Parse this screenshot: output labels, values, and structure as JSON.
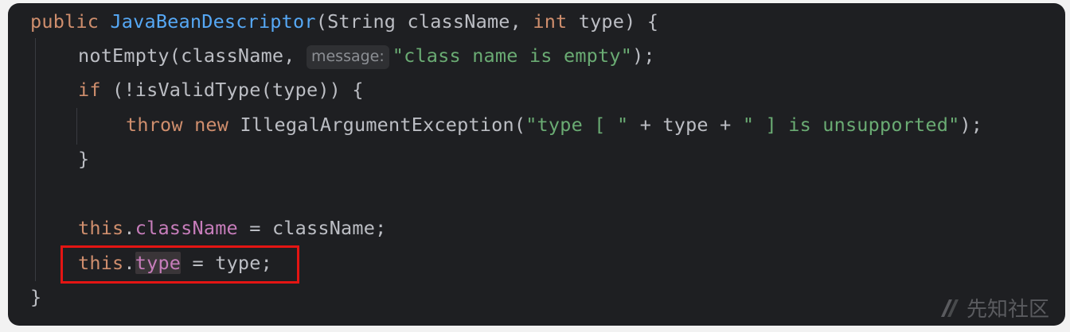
{
  "editor": {
    "language": "java",
    "line_numbers_shown": false,
    "inlay_hint": "message:",
    "lines": [
      {
        "indent": 0,
        "tokens": [
          {
            "t": "public ",
            "c": "kw"
          },
          {
            "t": "JavaBeanDescriptor",
            "c": "fn"
          },
          {
            "t": "(String className, ",
            "c": "plain"
          },
          {
            "t": "int",
            "c": "kw"
          },
          {
            "t": " type) {",
            "c": "plain"
          }
        ]
      },
      {
        "indent": 1,
        "tokens": [
          {
            "t": "notEmpty(className, ",
            "c": "plain"
          },
          {
            "t": "message:",
            "c": "hint"
          },
          {
            "t": "\"class name is empty\"",
            "c": "str"
          },
          {
            "t": ");",
            "c": "plain"
          }
        ]
      },
      {
        "indent": 1,
        "tokens": [
          {
            "t": "if",
            "c": "kw"
          },
          {
            "t": " (!isValidType(type)) {",
            "c": "plain"
          }
        ]
      },
      {
        "indent": 2,
        "tokens": [
          {
            "t": "throw new ",
            "c": "kw"
          },
          {
            "t": "IllegalArgumentException(",
            "c": "plain"
          },
          {
            "t": "\"type [ \"",
            "c": "str"
          },
          {
            "t": " + type + ",
            "c": "plain"
          },
          {
            "t": "\" ] is unsupported\"",
            "c": "str"
          },
          {
            "t": ");",
            "c": "plain"
          }
        ]
      },
      {
        "indent": 1,
        "tokens": [
          {
            "t": "}",
            "c": "plain"
          }
        ]
      },
      {
        "indent": 1,
        "tokens": []
      },
      {
        "indent": 1,
        "tokens": [
          {
            "t": "this",
            "c": "kw"
          },
          {
            "t": ".",
            "c": "plain"
          },
          {
            "t": "className",
            "c": "fld"
          },
          {
            "t": " = className;",
            "c": "plain"
          }
        ]
      },
      {
        "indent": 1,
        "tokens": [
          {
            "t": "this",
            "c": "kw"
          },
          {
            "t": ".",
            "c": "plain"
          },
          {
            "t": "type",
            "c": "fld-hl"
          },
          {
            "t": " = type;",
            "c": "plain"
          }
        ]
      },
      {
        "indent": 0,
        "tokens": [
          {
            "t": "}",
            "c": "plain"
          }
        ]
      }
    ],
    "highlighted_line_index": 7
  },
  "colors": {
    "background": "#1e1f22",
    "keyword": "#cf8e6d",
    "method_declaration": "#56a8f5",
    "string": "#6aab73",
    "field": "#c77dbb",
    "plain": "#bcbec4",
    "annotation_box": "#e41513"
  },
  "watermark": {
    "text": "先知社区",
    "icon": "xianzhi-logo-icon"
  }
}
